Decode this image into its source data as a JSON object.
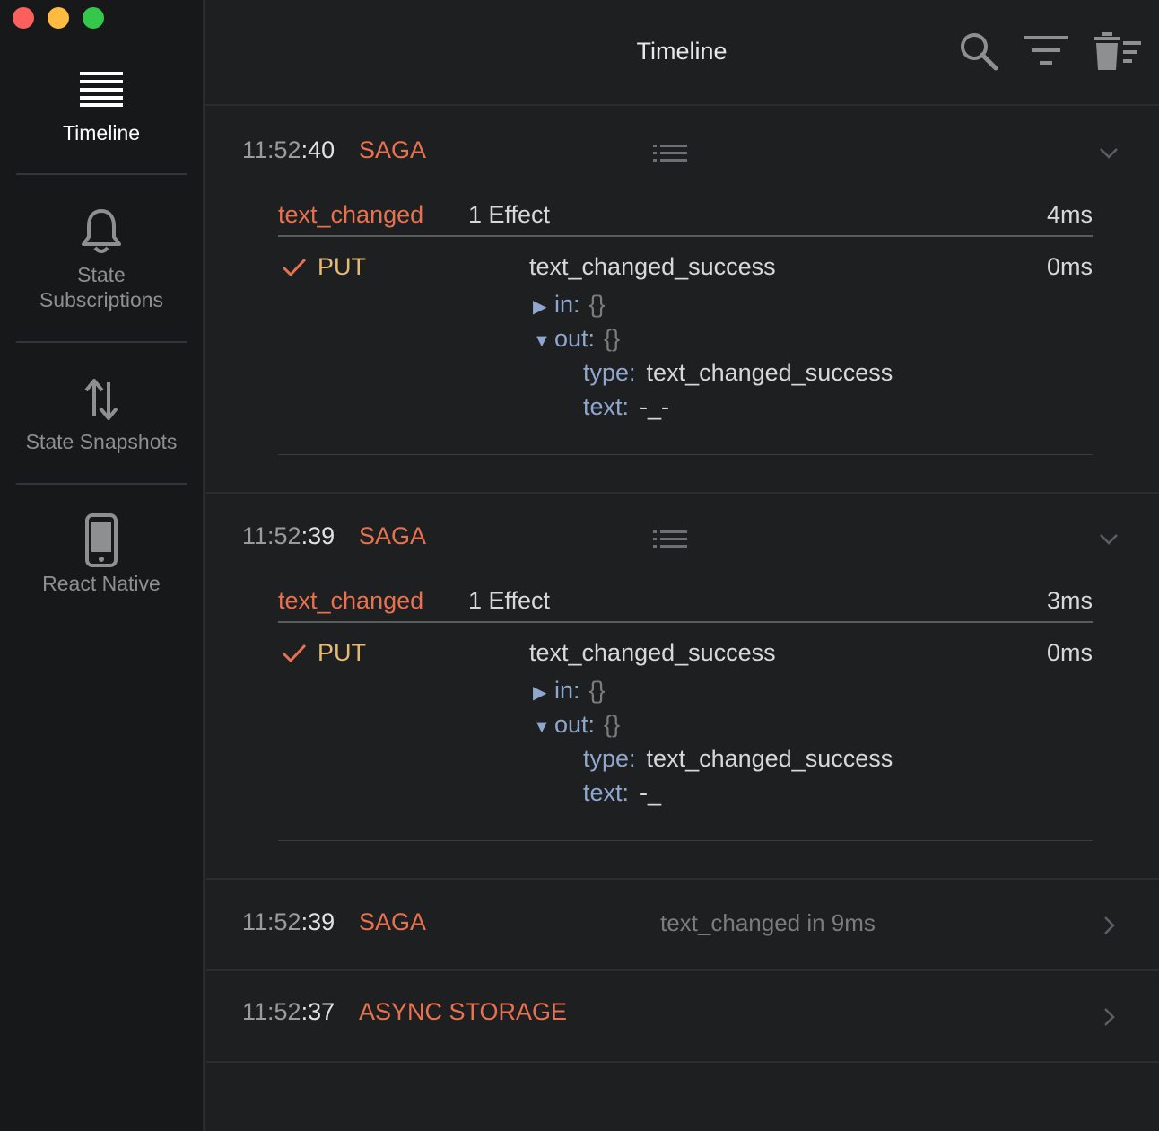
{
  "sidebar": {
    "items": [
      {
        "label": "Timeline",
        "icon": "list-icon",
        "active": true
      },
      {
        "label_line1": "State",
        "label_line2": "Subscriptions",
        "icon": "bell-icon"
      },
      {
        "label": "State Snapshots",
        "icon": "swap-arrows-icon"
      },
      {
        "label": "React Native",
        "icon": "phone-icon"
      }
    ]
  },
  "header": {
    "title": "Timeline",
    "icons": [
      "search-icon",
      "filter-icon",
      "trash-icon"
    ]
  },
  "entries": [
    {
      "time_prefix": "11:52",
      "time_suffix": ":40",
      "type": "SAGA",
      "saga": {
        "name": "text_changed",
        "effects": "1 Effect",
        "duration": "4ms"
      },
      "effect": {
        "type": "PUT",
        "name": "text_changed_success",
        "duration": "0ms",
        "in_key": "in:",
        "in_value": "{}",
        "out_key": "out:",
        "out_value": "{}",
        "type_key": "type:",
        "type_value": "text_changed_success",
        "text_key": "text:",
        "text_value": "-_-"
      }
    },
    {
      "time_prefix": "11:52",
      "time_suffix": ":39",
      "type": "SAGA",
      "saga": {
        "name": "text_changed",
        "effects": "1 Effect",
        "duration": "3ms"
      },
      "effect": {
        "type": "PUT",
        "name": "text_changed_success",
        "duration": "0ms",
        "in_key": "in:",
        "in_value": "{}",
        "out_key": "out:",
        "out_value": "{}",
        "type_key": "type:",
        "type_value": "text_changed_success",
        "text_key": "text:",
        "text_value": "-_"
      }
    },
    {
      "time_prefix": "11:52",
      "time_suffix": ":39",
      "type": "SAGA",
      "summary": "text_changed in 9ms"
    },
    {
      "time_prefix": "11:52",
      "time_suffix": ":37",
      "type": "ASYNC STORAGE"
    }
  ],
  "colors": {
    "accent": "#e8714f",
    "effect_type": "#e6ba72",
    "tree_key": "#8fa7cf",
    "background": "#1e1f21",
    "sidebar": "#17181a"
  }
}
